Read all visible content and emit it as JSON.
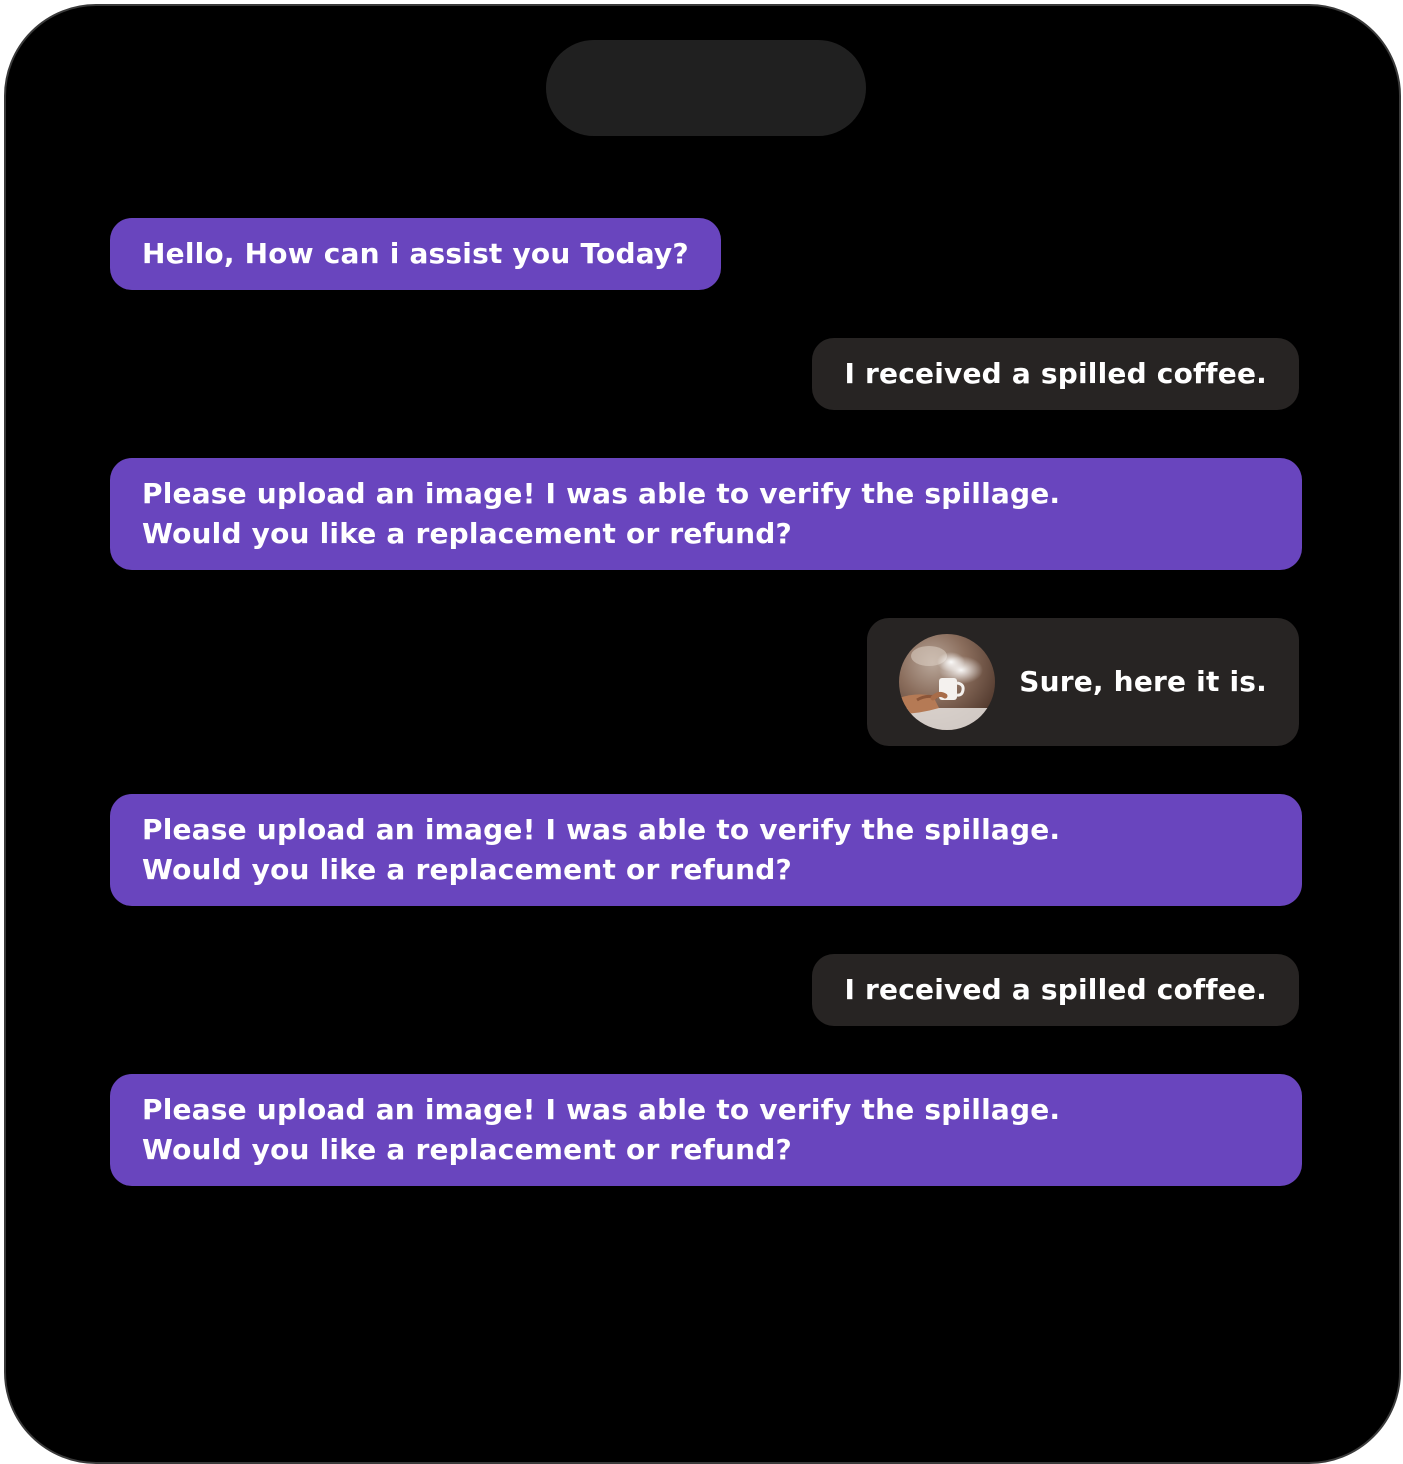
{
  "chat": {
    "messages": [
      {
        "sender": "assistant",
        "lines": [
          "Hello, How can i assist you Today?"
        ]
      },
      {
        "sender": "user",
        "lines": [
          "I received a spilled coffee."
        ]
      },
      {
        "sender": "assistant",
        "lines": [
          "Please upload an image! I was able to verify the spillage.",
          "Would you like a replacement or refund?"
        ]
      },
      {
        "sender": "user",
        "lines": [
          "Sure, here it is."
        ],
        "attachment_icon": "coffee-photo-thumbnail"
      },
      {
        "sender": "assistant",
        "lines": [
          "Please upload an image! I was able to verify the spillage.",
          "Would you like a replacement or refund?"
        ]
      },
      {
        "sender": "user",
        "lines": [
          "I received a spilled coffee."
        ]
      },
      {
        "sender": "assistant",
        "lines": [
          "Please upload an image! I was able to verify the spillage.",
          "Would you like a replacement or refund?"
        ]
      }
    ]
  },
  "colors": {
    "assistant_bubble": "#6945be",
    "user_bubble": "#272423",
    "background": "#000000",
    "text": "#ffffff"
  }
}
